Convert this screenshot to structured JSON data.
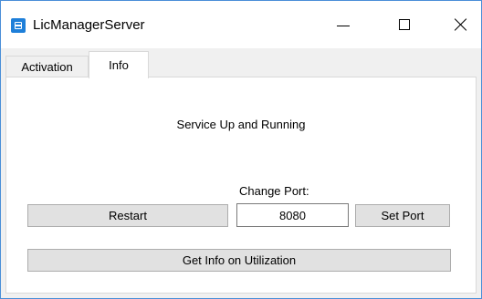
{
  "window": {
    "title": "LicManagerServer",
    "accent_color": "#1e7fd9"
  },
  "tabs": [
    {
      "label": "Activation",
      "selected": false
    },
    {
      "label": "Info",
      "selected": true
    }
  ],
  "info": {
    "status_text": "Service Up and Running",
    "change_port_label": "Change Port:",
    "port_value": "8080",
    "restart_label": "Restart",
    "set_port_label": "Set Port",
    "get_info_label": "Get Info on Utilization"
  }
}
